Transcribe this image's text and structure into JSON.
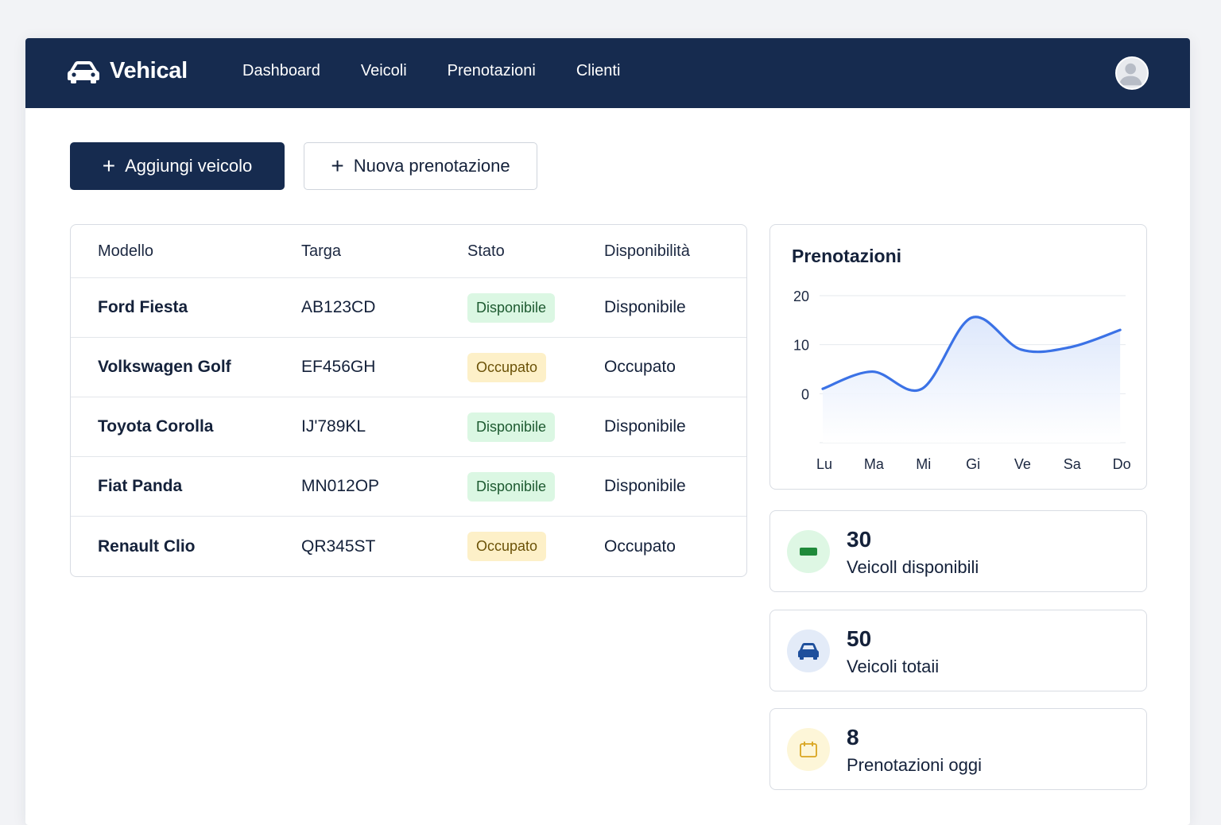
{
  "app": {
    "name": "Vehical"
  },
  "nav": {
    "items": [
      "Dashboard",
      "Veicoli",
      "Prenotazioni",
      "Clienti"
    ]
  },
  "actions": {
    "add_vehicle": "Aggiungi veicolo",
    "new_booking": "Nuova prenotazione"
  },
  "table": {
    "headers": [
      "Modello",
      "Targa",
      "Stato",
      "Disponibilità"
    ],
    "rows": [
      {
        "model": "Ford Fiesta",
        "plate": "AB123CD",
        "status": "Disponibile",
        "availability": "Disponibile"
      },
      {
        "model": "Volkswagen Golf",
        "plate": "EF456GH",
        "status": "Occupato",
        "availability": "Occupato"
      },
      {
        "model": "Toyota Corolla",
        "plate": "IJ'789KL",
        "status": "Disponibile",
        "availability": "Disponibile"
      },
      {
        "model": "Fiat Panda",
        "plate": "MN012OP",
        "status": "Disponibile",
        "availability": "Disponibile"
      },
      {
        "model": "Renault Clio",
        "plate": "QR345ST",
        "status": "Occupato",
        "availability": "Occupato"
      }
    ]
  },
  "chart_data": {
    "type": "area",
    "title": "Prenotazioni",
    "categories": [
      "Lu",
      "Ma",
      "Mi",
      "Gi",
      "Ve",
      "Sa",
      "Do"
    ],
    "values": [
      1,
      4.5,
      1,
      15.5,
      9,
      9.5,
      13
    ],
    "y_ticks": [
      "20",
      "10",
      "0"
    ],
    "ylim": [
      -10,
      20
    ],
    "grid": true,
    "line_color": "#3b72e6"
  },
  "stats": [
    {
      "value": "30",
      "label": "Veicoll disponibili",
      "icon": "green-card-icon",
      "color": "#1f8a3a"
    },
    {
      "value": "50",
      "label": "Veicoli totaii",
      "icon": "car-icon",
      "color": "#1e4f9c"
    },
    {
      "value": "8",
      "label": "Prenotazioni oggi",
      "icon": "calendar-icon",
      "color": "#d9a520"
    }
  ],
  "colors": {
    "navbar": "#162b4f",
    "primary_button": "#162b4f",
    "available_badge": "#dbf7e3",
    "busy_badge": "#fdf0c8"
  }
}
